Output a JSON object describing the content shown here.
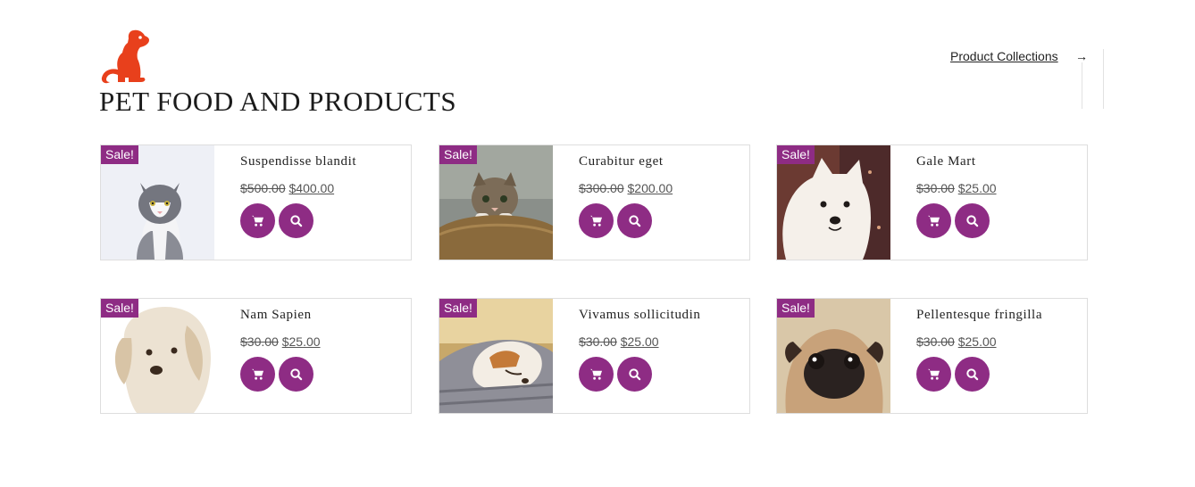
{
  "header": {
    "title": "PET FOOD AND PRODUCTS",
    "collections_link": "Product Collections",
    "arrow": "→"
  },
  "colors": {
    "accent": "#8e2c84",
    "logo": "#e8401c"
  },
  "products": [
    {
      "name": "Suspendisse blandit",
      "old_price": "$500.00",
      "new_price": "$400.00",
      "badge": "Sale!"
    },
    {
      "name": "Curabitur eget",
      "old_price": "$300.00",
      "new_price": "$200.00",
      "badge": "Sale!"
    },
    {
      "name": "Gale Mart",
      "old_price": "$30.00",
      "new_price": "$25.00",
      "badge": "Sale!"
    },
    {
      "name": "Nam Sapien",
      "old_price": "$30.00",
      "new_price": "$25.00",
      "badge": "Sale!"
    },
    {
      "name": "Vivamus sollicitudin",
      "old_price": "$30.00",
      "new_price": "$25.00",
      "badge": "Sale!"
    },
    {
      "name": "Pellentesque fringilla",
      "old_price": "$30.00",
      "new_price": "$25.00",
      "badge": "Sale!"
    }
  ],
  "icons": {
    "cart": "cart-icon",
    "search": "search-icon",
    "logo": "dog-logo-icon"
  }
}
